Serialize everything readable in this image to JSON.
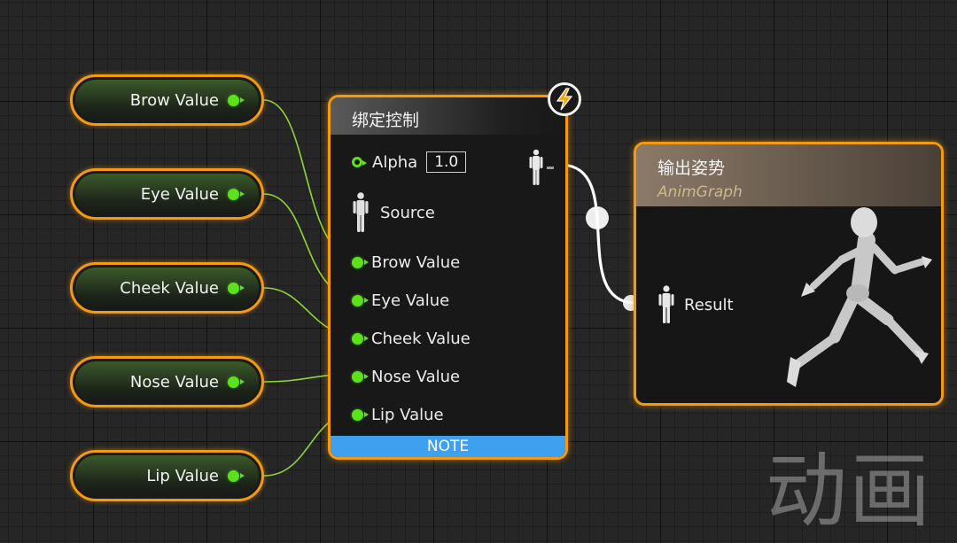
{
  "variables": [
    {
      "label": "Brow Value"
    },
    {
      "label": "Eye Value"
    },
    {
      "label": "Cheek Value"
    },
    {
      "label": "Nose Value"
    },
    {
      "label": "Lip Value"
    }
  ],
  "bind_node": {
    "title": "绑定控制",
    "alpha_label": "Alpha",
    "alpha_value": "1.0",
    "source_label": "Source",
    "pins": [
      {
        "label": "Brow Value"
      },
      {
        "label": "Eye Value"
      },
      {
        "label": "Cheek Value"
      },
      {
        "label": "Nose Value"
      },
      {
        "label": "Lip Value"
      }
    ],
    "note": "NOTE",
    "badge_icon": "lightning-bolt-icon"
  },
  "output_node": {
    "title": "输出姿势",
    "subtitle": "AnimGraph",
    "result_label": "Result",
    "preview_icon": "running-mannequin-icon"
  },
  "watermark": "动画",
  "colors": {
    "node_border": "#f59a0f",
    "float_pin": "#5ce21a",
    "pose_wire": "#ffffff",
    "note_bar": "#3fa0ef",
    "subtitle": "#cdb98a"
  }
}
